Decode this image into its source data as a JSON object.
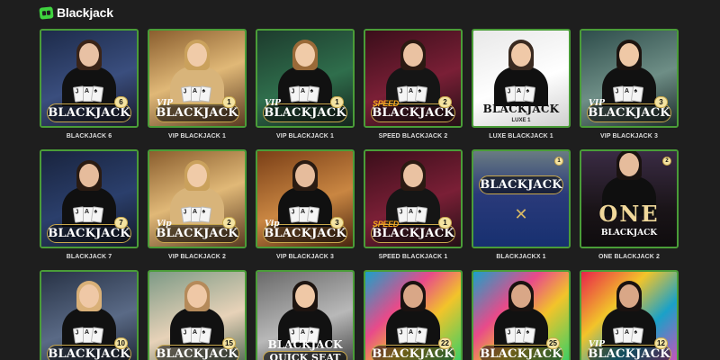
{
  "header": {
    "title": "Blackjack",
    "logo_icon": "blackjack-cards-icon"
  },
  "tiles": [
    {
      "label": "BLACKJACK 6",
      "plate": "BLACKJACK",
      "prefix": "",
      "badge": "6",
      "theme": "blue",
      "style": "std"
    },
    {
      "label": "VIP BLACKJACK 1",
      "plate": "BLACKJACK",
      "prefix": "VIP",
      "badge": "1",
      "theme": "gold",
      "style": "std"
    },
    {
      "label": "VIP BLACKJACK 1",
      "plate": "BLACKJACK",
      "prefix": "VIP",
      "badge": "1",
      "theme": "green",
      "style": "std"
    },
    {
      "label": "SPEED BLACKJACK 2",
      "plate": "BLACKJACK",
      "prefix": "SPEED",
      "badge": "2",
      "theme": "crimson",
      "style": "std"
    },
    {
      "label": "LUXE BLACKJACK 1",
      "plate": "BLACKJACK",
      "prefix": "",
      "badge": "",
      "theme": "white",
      "style": "luxe",
      "sub": "LUXE 1"
    },
    {
      "label": "VIP BLACKJACK 3",
      "plate": "BLACKJACK",
      "prefix": "VIP",
      "badge": "3",
      "theme": "teal",
      "style": "std"
    },
    {
      "label": "BLACKJACK 7",
      "plate": "BLACKJACK",
      "prefix": "",
      "badge": "7",
      "theme": "navy",
      "style": "std"
    },
    {
      "label": "VIP BLACKJACK 2",
      "plate": "BLACKJACK",
      "prefix": "Vip",
      "badge": "2",
      "theme": "gold",
      "style": "std"
    },
    {
      "label": "VIP BLACKJACK 3",
      "plate": "BLACKJACK",
      "prefix": "Vip",
      "badge": "3",
      "theme": "amber",
      "style": "std"
    },
    {
      "label": "SPEED BLACKJACK 1",
      "plate": "BLACKJACK",
      "prefix": "SPEED",
      "badge": "1",
      "theme": "crimson",
      "style": "std"
    },
    {
      "label": "BLACKJACKX 1",
      "plate": "BLACKJACK",
      "prefix": "",
      "badge": "1",
      "theme": "felt",
      "style": "x"
    },
    {
      "label": "ONE BLACKJACK 2",
      "plate": "",
      "prefix": "",
      "badge": "2",
      "theme": "dark",
      "style": "one",
      "big": "ONE",
      "sub": "BLACKJACK"
    },
    {
      "label": "",
      "plate": "BLACKJACK",
      "prefix": "",
      "badge": "10",
      "theme": "slate",
      "style": "std"
    },
    {
      "label": "",
      "plate": "BLACKJACK",
      "prefix": "",
      "badge": "15",
      "theme": "pastel",
      "style": "std"
    },
    {
      "label": "",
      "plate": "BLACKJACK",
      "prefix": "",
      "badge": "",
      "theme": "grey",
      "style": "qs",
      "sub": "QUICK SEAT"
    },
    {
      "label": "",
      "plate": "BLACKJACK",
      "prefix": "",
      "badge": "22",
      "theme": "graffiti",
      "style": "std"
    },
    {
      "label": "",
      "plate": "BLACKJACK",
      "prefix": "",
      "badge": "25",
      "theme": "graffiti",
      "style": "std"
    },
    {
      "label": "",
      "plate": "BLACKJACK",
      "prefix": "VIP",
      "badge": "12",
      "theme": "graffiti2",
      "style": "std"
    }
  ],
  "colors": {
    "background": "#1e1e1e",
    "tile_border": "#4a9d38",
    "accent_green": "#3fd33f",
    "plate_gold": "#c9a84c"
  }
}
